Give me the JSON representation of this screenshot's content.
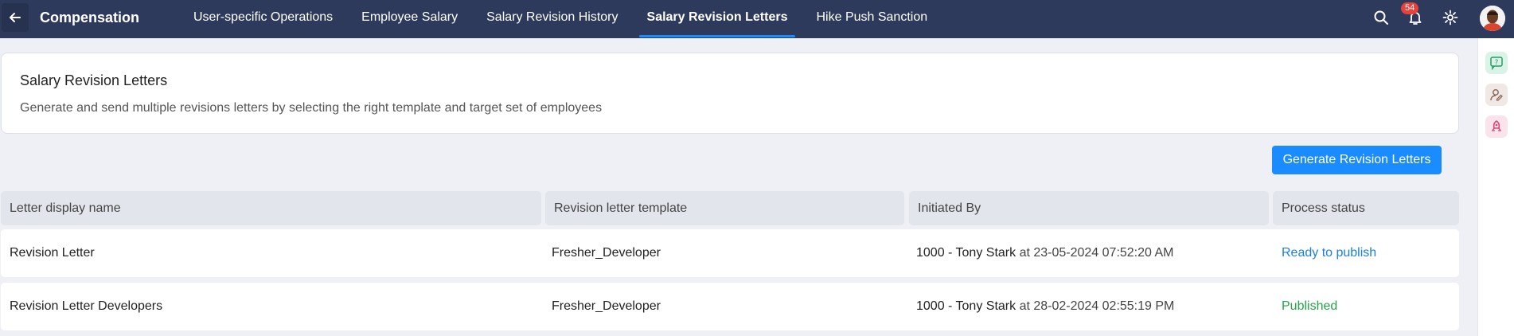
{
  "header": {
    "title": "Compensation",
    "tabs": [
      {
        "label": "User-specific Operations"
      },
      {
        "label": "Employee Salary"
      },
      {
        "label": "Salary Revision History"
      },
      {
        "label": "Salary Revision Letters"
      },
      {
        "label": "Hike Push Sanction"
      }
    ],
    "active_tab": "Salary Revision Letters",
    "notification_count": "54",
    "icons": [
      "back-arrow-icon",
      "search-icon",
      "bell-icon",
      "gear-icon",
      "avatar"
    ]
  },
  "rail": {
    "icons": [
      "help-chat-icon",
      "user-edit-icon",
      "rocket-icon"
    ]
  },
  "info": {
    "title": "Salary Revision Letters",
    "description": "Generate and send multiple revisions letters by selecting the right template and target set of employees"
  },
  "actions": {
    "generate_label": "Generate Revision Letters"
  },
  "table": {
    "columns": [
      "Letter display name",
      "Revision letter template",
      "Initiated By",
      "Process status"
    ],
    "rows": [
      {
        "name": "Revision Letter",
        "template": "Fresher_Developer",
        "initiator": "1000 - Tony Stark",
        "at": "at 23-05-2024 07:52:20 AM",
        "status": "Ready to publish"
      },
      {
        "name": "Revision Letter Developers",
        "template": "Fresher_Developer",
        "initiator": "1000 - Tony Stark",
        "at": "at 28-02-2024 02:55:19 PM",
        "status": "Published"
      }
    ]
  },
  "colors": {
    "topbar": "#2e3a5c",
    "accent": "#1a8cff",
    "ready": "#1a7fe0",
    "published": "#23a548",
    "badge": "#e8403a"
  }
}
